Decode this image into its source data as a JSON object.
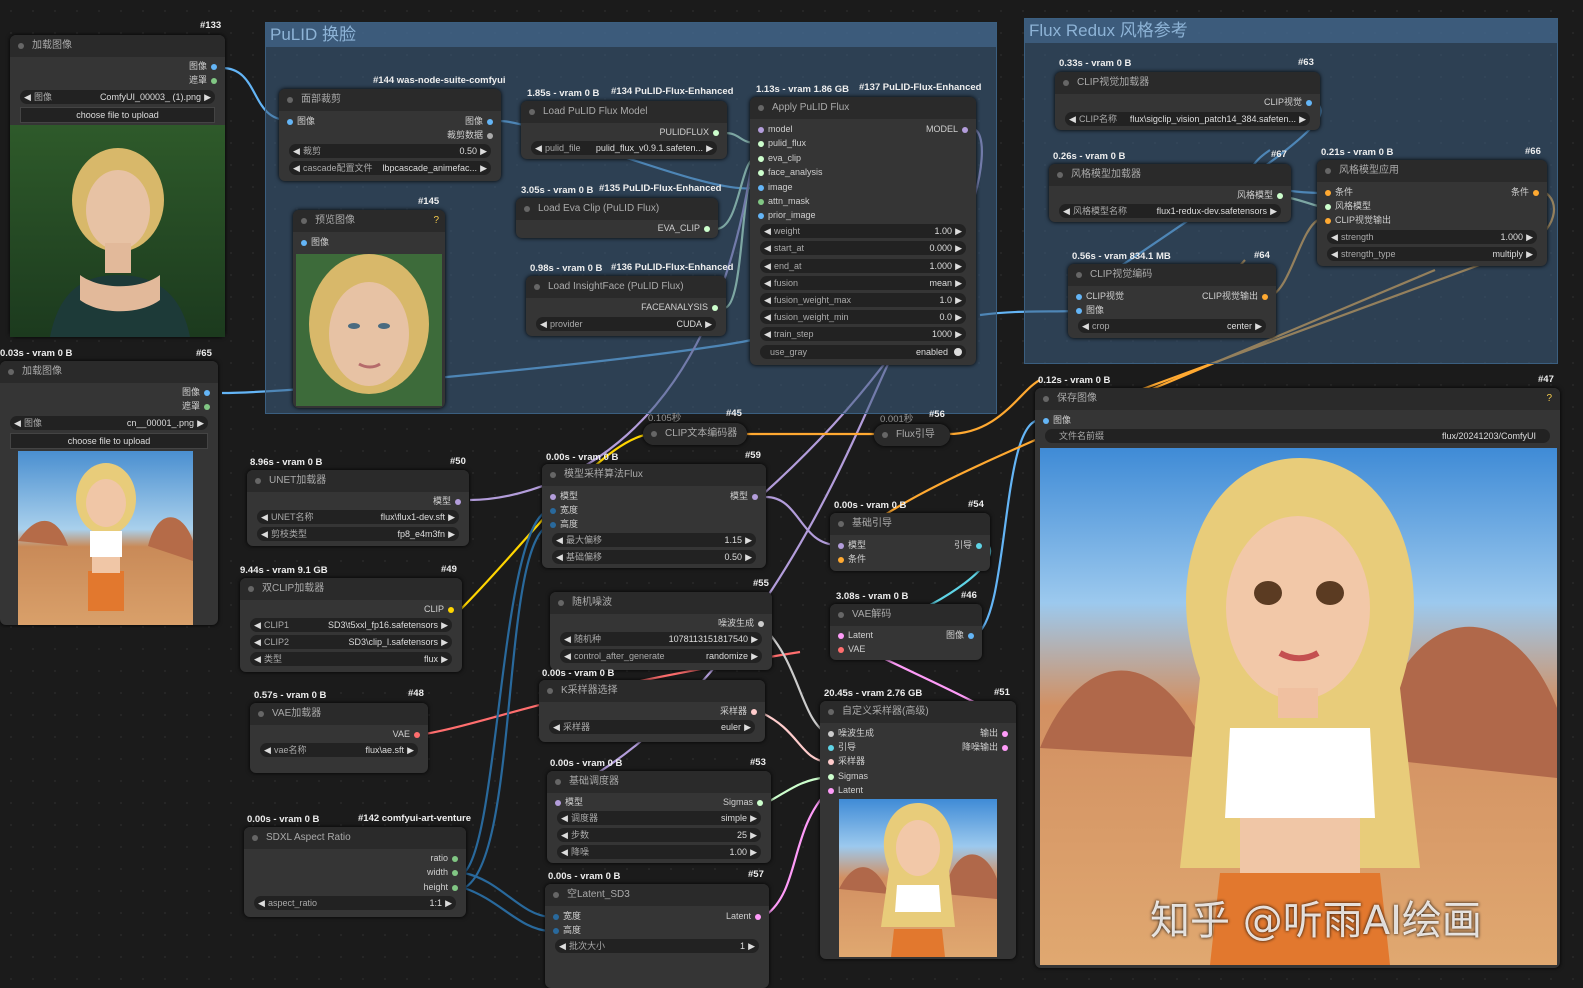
{
  "groups": {
    "pulid": "PuLID 换脸",
    "redux": "Flux Redux 风格参考"
  },
  "n133": {
    "id": "#133",
    "title": "加载图像",
    "o1": "图像",
    "o2": "遮罩",
    "img_label": "图像",
    "img_value": "ComfyUI_00003_ (1).png",
    "upload": "choose file to upload"
  },
  "n65": {
    "stat": "0.03s - vram 0 B",
    "id": "#65",
    "title": "加载图像",
    "o1": "图像",
    "o2": "遮罩",
    "img_label": "图像",
    "img_value": "cn__00001_.png",
    "upload": "choose file to upload"
  },
  "n144": {
    "id": "#144 was-node-suite-comfyui",
    "title": "面部裁剪",
    "i1": "图像",
    "o1": "图像",
    "o2": "裁剪数据",
    "w1l": "裁剪",
    "w1v": "0.50",
    "w2l": "cascade配置文件",
    "w2v": "lbpcascade_animefac..."
  },
  "n145": {
    "id": "#145",
    "title": "预览图像",
    "i1": "图像",
    "q": "?"
  },
  "n134": {
    "stat": "1.85s - vram 0 B",
    "id": "#134 PuLID-Flux-Enhanced",
    "title": "Load PuLID Flux Model",
    "o1": "PULIDFLUX",
    "w1l": "pulid_file",
    "w1v": "pulid_flux_v0.9.1.safeten..."
  },
  "n135": {
    "stat": "3.05s - vram 0 B",
    "id": "#135 PuLID-Flux-Enhanced",
    "title": "Load Eva Clip (PuLID Flux)",
    "o1": "EVA_CLIP"
  },
  "n136": {
    "stat": "0.98s - vram 0 B",
    "id": "#136 PuLID-Flux-Enhanced",
    "title": "Load InsightFace (PuLID Flux)",
    "o1": "FACEANALYSIS",
    "w1l": "provider",
    "w1v": "CUDA"
  },
  "n137": {
    "stat": "1.13s - vram 1.86 GB",
    "id": "#137 PuLID-Flux-Enhanced",
    "title": "Apply PuLID Flux",
    "inputs": [
      "model",
      "pulid_flux",
      "eva_clip",
      "face_analysis",
      "image",
      "attn_mask",
      "prior_image"
    ],
    "o1": "MODEL",
    "widgets": [
      [
        "weight",
        "1.00"
      ],
      [
        "start_at",
        "0.000"
      ],
      [
        "end_at",
        "1.000"
      ],
      [
        "fusion",
        "mean"
      ],
      [
        "fusion_weight_max",
        "1.0"
      ],
      [
        "fusion_weight_min",
        "0.0"
      ],
      [
        "train_step",
        "1000"
      ]
    ],
    "toggle_l": "use_gray",
    "toggle_v": "enabled"
  },
  "n63": {
    "stat": "0.33s - vram 0 B",
    "id": "#63",
    "title": "CLIP视觉加载器",
    "o1": "CLIP视觉",
    "w1l": "CLIP名称",
    "w1v": "flux\\sigclip_vision_patch14_384.safeten..."
  },
  "n67": {
    "stat": "0.26s - vram 0 B",
    "id": "#67",
    "title": "风格模型加载器",
    "o1": "风格模型",
    "w1l": "风格模型名称",
    "w1v": "flux1-redux-dev.safetensors"
  },
  "n66": {
    "stat": "0.21s - vram 0 B",
    "id": "#66",
    "title": "风格模型应用",
    "i1": "条件",
    "i2": "风格模型",
    "i3": "CLIP视觉输出",
    "o1": "条件",
    "w1l": "strength",
    "w1v": "1.000",
    "w2l": "strength_type",
    "w2v": "multiply"
  },
  "n64": {
    "stat": "0.56s - vram 834.1 MB",
    "id": "#64",
    "title": "CLIP视觉编码",
    "i1": "CLIP视觉",
    "i2": "图像",
    "o1": "CLIP视觉输出",
    "w1l": "crop",
    "w1v": "center"
  },
  "n45": {
    "stat": "0.105秒",
    "id": "#45",
    "title": "CLIP文本编码器"
  },
  "n56": {
    "stat": "0.001秒",
    "id": "#56",
    "title": "Flux引导"
  },
  "n47": {
    "stat": "0.12s - vram 0 B",
    "id": "#47",
    "title": "保存图像",
    "i1": "图像",
    "w1l": "文件名前缀",
    "w1v": "flux/20241203/ComfyUI",
    "q": "?"
  },
  "n50": {
    "stat": "8.96s - vram 0 B",
    "id": "#50",
    "title": "UNET加载器",
    "o1": "模型",
    "w1l": "UNET名称",
    "w1v": "flux\\flux1-dev.sft",
    "w2l": "剪枝类型",
    "w2v": "fp8_e4m3fn"
  },
  "n59": {
    "stat": "0.00s - vram 0 B",
    "id": "#59",
    "title": "模型采样算法Flux",
    "i1": "模型",
    "i2": "宽度",
    "i3": "高度",
    "o1": "模型",
    "w1l": "最大偏移",
    "w1v": "1.15",
    "w2l": "基础偏移",
    "w2v": "0.50"
  },
  "n54": {
    "stat": "0.00s - vram 0 B",
    "id": "#54",
    "title": "基础引导",
    "i1": "模型",
    "i2": "条件",
    "o1": "引导"
  },
  "n49": {
    "stat": "9.44s - vram 9.1 GB",
    "id": "#49",
    "title": "双CLIP加载器",
    "o1": "CLIP",
    "w1l": "CLIP1",
    "w1v": "SD3\\t5xxl_fp16.safetensors",
    "w2l": "CLIP2",
    "w2v": "SD3\\clip_l.safetensors",
    "w3l": "类型",
    "w3v": "flux"
  },
  "n55": {
    "id": "#55",
    "title": "随机噪波",
    "o1": "噪波生成",
    "w1l": "随机种",
    "w1v": "1078113151817540",
    "w2l": "control_after_generate",
    "w2v": "randomize"
  },
  "n46": {
    "stat": "3.08s - vram 0 B",
    "id": "#46",
    "title": "VAE解码",
    "i1": "Latent",
    "i2": "VAE",
    "o1": "图像"
  },
  "n48": {
    "stat": "0.57s - vram 0 B",
    "id": "#48",
    "title": "VAE加载器",
    "o1": "VAE",
    "w1l": "vae名称",
    "w1v": "flux\\ae.sft"
  },
  "n52": {
    "stat": "0.00s - vram 0 B",
    "title": "K采样器选择",
    "o1": "采样器",
    "w1l": "采样器",
    "w1v": "euler"
  },
  "n51": {
    "stat": "20.45s - vram 2.76 GB",
    "id": "#51",
    "title": "自定义采样器(高级)",
    "inputs": [
      "噪波生成",
      "引导",
      "采样器",
      "Sigmas",
      "Latent"
    ],
    "o1": "输出",
    "o2": "降噪输出"
  },
  "n53": {
    "stat": "0.00s - vram 0 B",
    "id": "#53",
    "title": "基础调度器",
    "i1": "模型",
    "o1": "Sigmas",
    "w1l": "调度器",
    "w1v": "simple",
    "w2l": "步数",
    "w2v": "25",
    "w3l": "降噪",
    "w3v": "1.00"
  },
  "n142": {
    "stat": "0.00s - vram 0 B",
    "id": "#142 comfyui-art-venture",
    "title": "SDXL Aspect Ratio",
    "o1": "ratio",
    "o2": "width",
    "o3": "height",
    "w1l": "aspect_ratio",
    "w1v": "1:1"
  },
  "n57": {
    "stat": "0.00s - vram 0 B",
    "id": "#57",
    "title": "空Latent_SD3",
    "i1": "宽度",
    "i2": "高度",
    "o1": "Latent",
    "w1l": "批次大小",
    "w1v": "1"
  },
  "watermark": "知乎 @听雨AI绘画",
  "colors": {
    "model": "#b39ddb",
    "clip": "#ffd500",
    "vae": "#ff6e6e",
    "image": "#64b5f6",
    "latent": "#ff9cf9",
    "conditioning": "#ffa931",
    "int": "#29699c",
    "sigmas": "#cdffcd"
  }
}
